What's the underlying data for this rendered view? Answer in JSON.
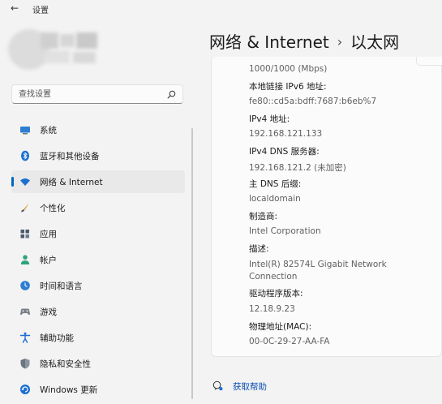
{
  "window": {
    "back_glyph": "←",
    "title": "设置"
  },
  "search": {
    "placeholder": "查找设置"
  },
  "nav": {
    "items": [
      {
        "label": "系统",
        "icon": "display-icon"
      },
      {
        "label": "蓝牙和其他设备",
        "icon": "bluetooth-icon"
      },
      {
        "label": "网络 & Internet",
        "icon": "wifi-icon",
        "selected": true
      },
      {
        "label": "个性化",
        "icon": "brush-icon"
      },
      {
        "label": "应用",
        "icon": "apps-icon"
      },
      {
        "label": "帐户",
        "icon": "person-icon"
      },
      {
        "label": "时间和语言",
        "icon": "globe-clock-icon"
      },
      {
        "label": "游戏",
        "icon": "gamepad-icon"
      },
      {
        "label": "辅助功能",
        "icon": "accessibility-icon"
      },
      {
        "label": "隐私和安全性",
        "icon": "shield-icon"
      },
      {
        "label": "Windows 更新",
        "icon": "update-icon"
      }
    ]
  },
  "header": {
    "crumb": "网络 & Internet",
    "separator": "›",
    "current": "以太网"
  },
  "properties": {
    "link_speed_value": "1000/1000 (Mbps)",
    "ipv6_label": "本地链接 IPv6 地址:",
    "ipv6_value": "fe80::cd5a:bdff:7687:b6eb%7",
    "ipv4_label": "IPv4 地址:",
    "ipv4_value": "192.168.121.133",
    "dns_label": "IPv4 DNS 服务器:",
    "dns_value": "192.168.121.2 (未加密)",
    "dns_suffix_label": "主 DNS 后缀:",
    "dns_suffix_value": "localdomain",
    "manufacturer_label": "制造商:",
    "manufacturer_value": "Intel Corporation",
    "description_label": "描述:",
    "description_value_line1": "Intel(R) 82574L Gigabit Network",
    "description_value_line2": "Connection",
    "driver_label": "驱动程序版本:",
    "driver_value": "12.18.9.23",
    "mac_label": "物理地址(MAC):",
    "mac_value": "00-0C-29-27-AA-FA"
  },
  "help": {
    "label": "获取帮助"
  },
  "colors": {
    "accent": "#0067c0",
    "link": "#0b4fb1",
    "background": "#f3f3f3",
    "card": "#fbfbfb"
  }
}
